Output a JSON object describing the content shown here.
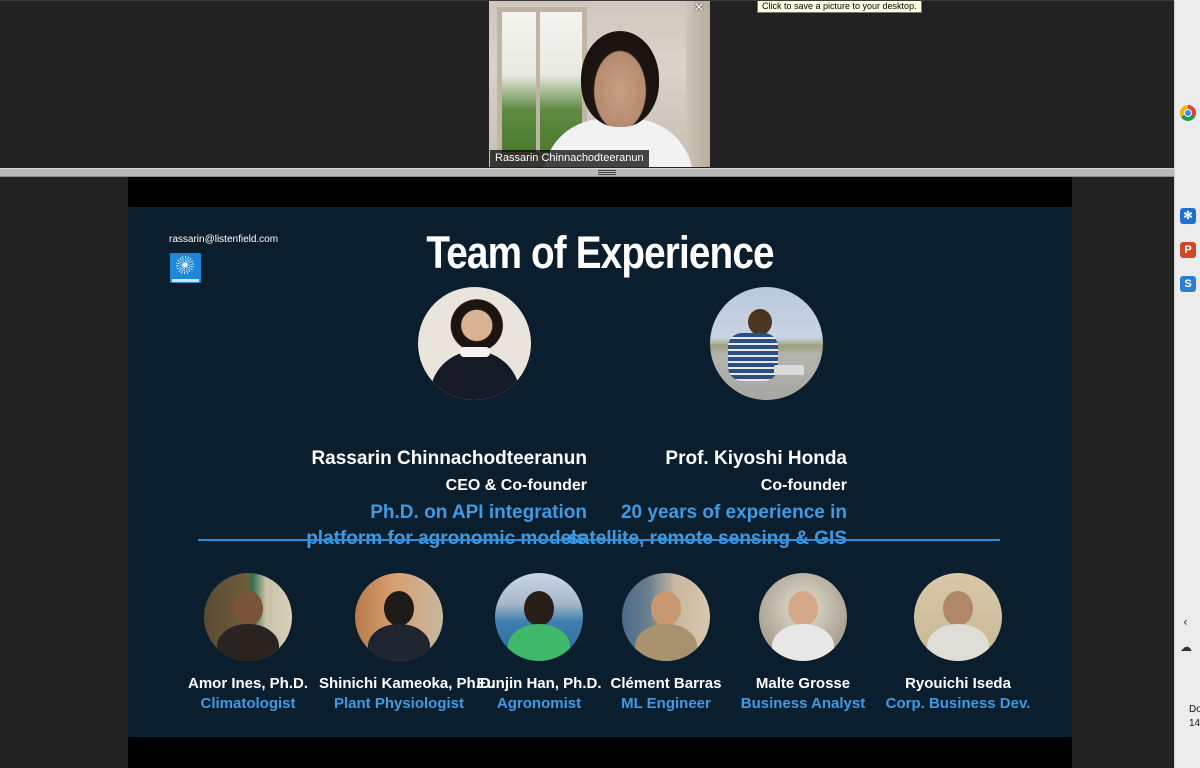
{
  "video": {
    "participant_name": "Rassarin Chinnachodteeranun",
    "close_symbol": "×"
  },
  "tooltip": "Click to save a picture to your desktop.",
  "slide": {
    "email": "rassarin@listenfield.com",
    "logo_icon": "listenfield-logo-icon",
    "title": "Team of Experience",
    "accent_color": "#3d9be6",
    "background_color": "#0b1e2e",
    "leaders": [
      {
        "name": "Rassarin Chinnachodteeranun",
        "role": "CEO & Co-founder",
        "desc_line1": "Ph.D. on API integration",
        "desc_line2": "platform for agronomic models"
      },
      {
        "name": "Prof. Kiyoshi Honda",
        "role": "Co-founder",
        "desc_line1": "20 years of experience in",
        "desc_line2": "satellite, remote sensing & GIS"
      }
    ],
    "members": [
      {
        "name": "Amor Ines, Ph.D.",
        "role": "Climatologist"
      },
      {
        "name": "Shinichi Kameoka, Ph.D.",
        "role": "Plant Physiologist"
      },
      {
        "name": "Eunjin Han, Ph.D.",
        "role": "Agronomist"
      },
      {
        "name": "Clément Barras",
        "role": "ML Engineer"
      },
      {
        "name": "Malte Grosse",
        "role": "Business Analyst"
      },
      {
        "name": "Ryouichi Iseda",
        "role": "Corp. Business Dev."
      }
    ]
  },
  "taskbar": {
    "icons": [
      "chrome-icon",
      "snowflake-icon",
      "powerpoint-icon",
      "snagit-icon",
      "chevron-left-icon",
      "cloud-icon"
    ],
    "powerpoint_letter": "P",
    "snagit_letter": "S",
    "clock_fragment": "Do 14"
  }
}
